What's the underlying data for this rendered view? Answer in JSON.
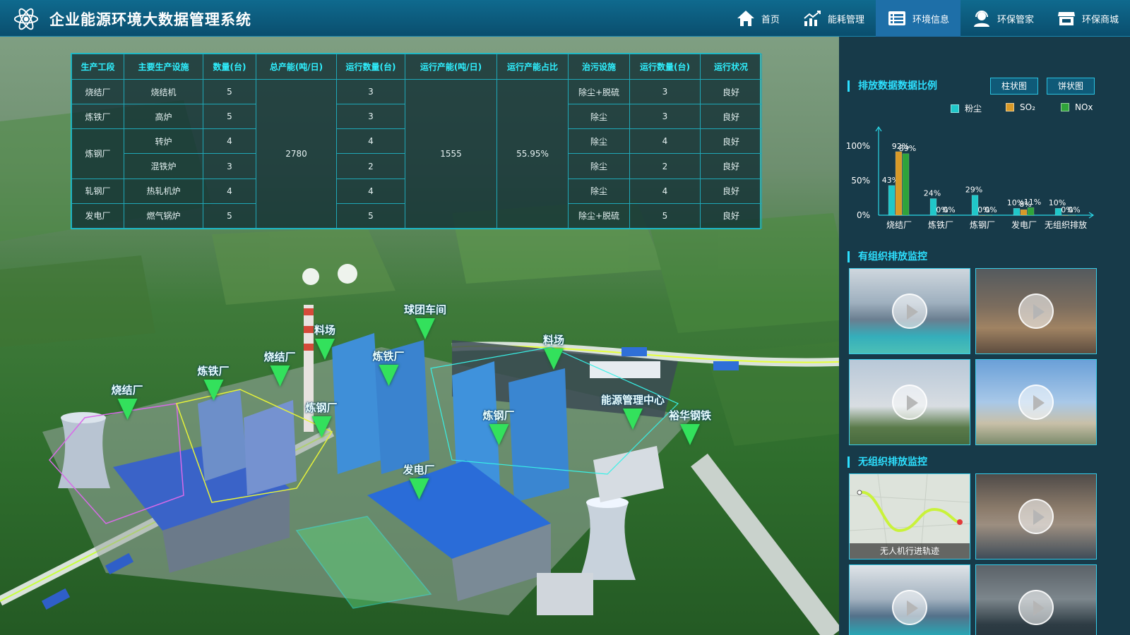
{
  "app": {
    "title": "企业能源环境大数据管理系统"
  },
  "nav": [
    {
      "label": "首页",
      "icon": "home-icon"
    },
    {
      "label": "能耗管理",
      "icon": "chart-trend-icon"
    },
    {
      "label": "环境信息",
      "icon": "list-icon",
      "active": true
    },
    {
      "label": "环保管家",
      "icon": "user-headset-icon"
    },
    {
      "label": "环保商城",
      "icon": "store-icon"
    }
  ],
  "table": {
    "headers": [
      "生产工段",
      "主要生产设施",
      "数量(台)",
      "总产能(吨/日)",
      "运行数量(台)",
      "运行产能(吨/日)",
      "运行产能占比",
      "治污设施",
      "运行数量(台)",
      "运行状况"
    ],
    "sections": [
      "烧结厂",
      "炼铁厂",
      "炼钢厂",
      "轧钢厂",
      "发电厂"
    ],
    "rows": [
      {
        "facility": "烧结机",
        "qty": "5",
        "run_qty": "3",
        "treatment": "除尘+脱硫",
        "treat_run": "3",
        "status": "良好"
      },
      {
        "facility": "高炉",
        "qty": "5",
        "run_qty": "3",
        "treatment": "除尘",
        "treat_run": "3",
        "status": "良好"
      },
      {
        "facility": "转炉",
        "qty": "4",
        "run_qty": "4",
        "treatment": "除尘",
        "treat_run": "4",
        "status": "良好"
      },
      {
        "facility": "混铁炉",
        "qty": "3",
        "run_qty": "2",
        "treatment": "除尘",
        "treat_run": "2",
        "status": "良好"
      },
      {
        "facility": "热轧机炉",
        "qty": "4",
        "run_qty": "4",
        "treatment": "除尘",
        "treat_run": "4",
        "status": "良好"
      },
      {
        "facility": "燃气锅炉",
        "qty": "5",
        "run_qty": "5",
        "treatment": "除尘+脱硫",
        "treat_run": "5",
        "status": "良好"
      }
    ],
    "total_capacity": "2780",
    "running_capacity": "1555",
    "running_ratio": "55.95%"
  },
  "emission": {
    "title": "排放数据数据比例",
    "btn_bar": "柱状图",
    "btn_pie": "饼状图",
    "legend": [
      {
        "name": "粉尘",
        "color": "#20c7c9"
      },
      {
        "name": "SO₂",
        "color": "#d89a28"
      },
      {
        "name": "NOx",
        "color": "#2fa33a"
      }
    ]
  },
  "chart_data": {
    "type": "bar",
    "categories": [
      "烧结厂",
      "炼铁厂",
      "炼钢厂",
      "发电厂",
      "无组织排放"
    ],
    "series": [
      {
        "name": "粉尘",
        "values": [
          43,
          24,
          29,
          10,
          10
        ]
      },
      {
        "name": "SO₂",
        "values": [
          92,
          0,
          0,
          8,
          0
        ]
      },
      {
        "name": "NOx",
        "values": [
          89,
          0,
          0,
          11,
          0
        ]
      }
    ],
    "value_labels": [
      [
        "43%",
        "24%",
        "29%",
        "10%",
        "10%"
      ],
      [
        "92%",
        "0%",
        "0%",
        "8%",
        "0%"
      ],
      [
        "89%",
        "0%",
        "0%",
        "11%",
        "0%"
      ]
    ],
    "yticks": [
      "0%",
      "50%",
      "100%"
    ],
    "ylim": [
      0,
      100
    ],
    "legend_position": "top-right"
  },
  "organized": {
    "title": "有组织排放监控"
  },
  "unorganized": {
    "title": "无组织排放监控",
    "drone_caption": "无人机行进轨迹"
  },
  "markers": [
    {
      "name": "烧结厂"
    },
    {
      "name": "炼铁厂"
    },
    {
      "name": "烧结厂"
    },
    {
      "name": "料场"
    },
    {
      "name": "球团车间"
    },
    {
      "name": "炼铁厂"
    },
    {
      "name": "炼钢厂"
    },
    {
      "name": "料场"
    },
    {
      "name": "炼钢厂"
    },
    {
      "name": "发电厂"
    },
    {
      "name": "能源管理中心"
    },
    {
      "name": "裕华钢铁"
    }
  ]
}
